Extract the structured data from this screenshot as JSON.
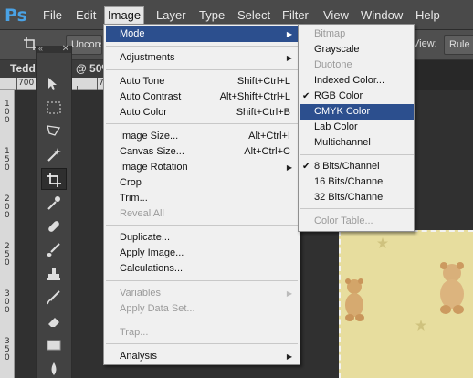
{
  "menubar": {
    "logo": "Ps",
    "items": [
      "File",
      "Edit",
      "Image",
      "Layer",
      "Type",
      "Select",
      "Filter",
      "View",
      "Window",
      "Help"
    ]
  },
  "options": {
    "constrain": "Uncons",
    "view_label": "View:",
    "rule_btn": "Rule o"
  },
  "document": {
    "tab_title": "Tedd",
    "zoom": "@ 50%"
  },
  "toolbox": {
    "close": "✕",
    "collapse": "«"
  },
  "ruler": {
    "top_labels": [
      "700",
      "75"
    ],
    "left_labels": [
      "1",
      "0",
      "0",
      "1",
      "5",
      "0",
      "2",
      "0",
      "0",
      "2",
      "5",
      "0",
      "3",
      "0",
      "0",
      "3",
      "5",
      "0"
    ]
  },
  "image_menu": {
    "items": [
      {
        "label": "Mode",
        "shortcut": "",
        "submenu": true,
        "disabled": false,
        "highlighted": true
      },
      {
        "label": "Adjustments",
        "shortcut": "",
        "submenu": true,
        "disabled": false
      },
      {
        "label": "Auto Tone",
        "shortcut": "Shift+Ctrl+L",
        "submenu": false,
        "disabled": false
      },
      {
        "label": "Auto Contrast",
        "shortcut": "Alt+Shift+Ctrl+L",
        "submenu": false,
        "disabled": false
      },
      {
        "label": "Auto Color",
        "shortcut": "Shift+Ctrl+B",
        "submenu": false,
        "disabled": false
      },
      {
        "label": "Image Size...",
        "shortcut": "Alt+Ctrl+I",
        "submenu": false,
        "disabled": false
      },
      {
        "label": "Canvas Size...",
        "shortcut": "Alt+Ctrl+C",
        "submenu": false,
        "disabled": false
      },
      {
        "label": "Image Rotation",
        "shortcut": "",
        "submenu": true,
        "disabled": false
      },
      {
        "label": "Crop",
        "shortcut": "",
        "submenu": false,
        "disabled": false
      },
      {
        "label": "Trim...",
        "shortcut": "",
        "submenu": false,
        "disabled": false
      },
      {
        "label": "Reveal All",
        "shortcut": "",
        "submenu": false,
        "disabled": true
      },
      {
        "label": "Duplicate...",
        "shortcut": "",
        "submenu": false,
        "disabled": false
      },
      {
        "label": "Apply Image...",
        "shortcut": "",
        "submenu": false,
        "disabled": false
      },
      {
        "label": "Calculations...",
        "shortcut": "",
        "submenu": false,
        "disabled": false
      },
      {
        "label": "Variables",
        "shortcut": "",
        "submenu": true,
        "disabled": true
      },
      {
        "label": "Apply Data Set...",
        "shortcut": "",
        "submenu": false,
        "disabled": true
      },
      {
        "label": "Trap...",
        "shortcut": "",
        "submenu": false,
        "disabled": true
      },
      {
        "label": "Analysis",
        "shortcut": "",
        "submenu": true,
        "disabled": false
      }
    ]
  },
  "mode_menu": {
    "items": [
      {
        "label": "Bitmap",
        "disabled": true,
        "checked": false
      },
      {
        "label": "Grayscale",
        "disabled": false,
        "checked": false
      },
      {
        "label": "Duotone",
        "disabled": true,
        "checked": false
      },
      {
        "label": "Indexed Color...",
        "disabled": false,
        "checked": false
      },
      {
        "label": "RGB Color",
        "disabled": false,
        "checked": true
      },
      {
        "label": "CMYK Color",
        "disabled": false,
        "checked": false,
        "highlighted": true
      },
      {
        "label": "Lab Color",
        "disabled": false,
        "checked": false
      },
      {
        "label": "Multichannel",
        "disabled": false,
        "checked": false
      },
      {
        "label": "8 Bits/Channel",
        "disabled": false,
        "checked": true
      },
      {
        "label": "16 Bits/Channel",
        "disabled": false,
        "checked": false
      },
      {
        "label": "32 Bits/Channel",
        "disabled": false,
        "checked": false
      },
      {
        "label": "Color Table...",
        "disabled": true,
        "checked": false
      }
    ],
    "check_glyph": "✔"
  },
  "colors": {
    "highlight": "#2c4f8e",
    "logo": "#4aa3e6",
    "photo_bg": "#e7dd9e"
  }
}
